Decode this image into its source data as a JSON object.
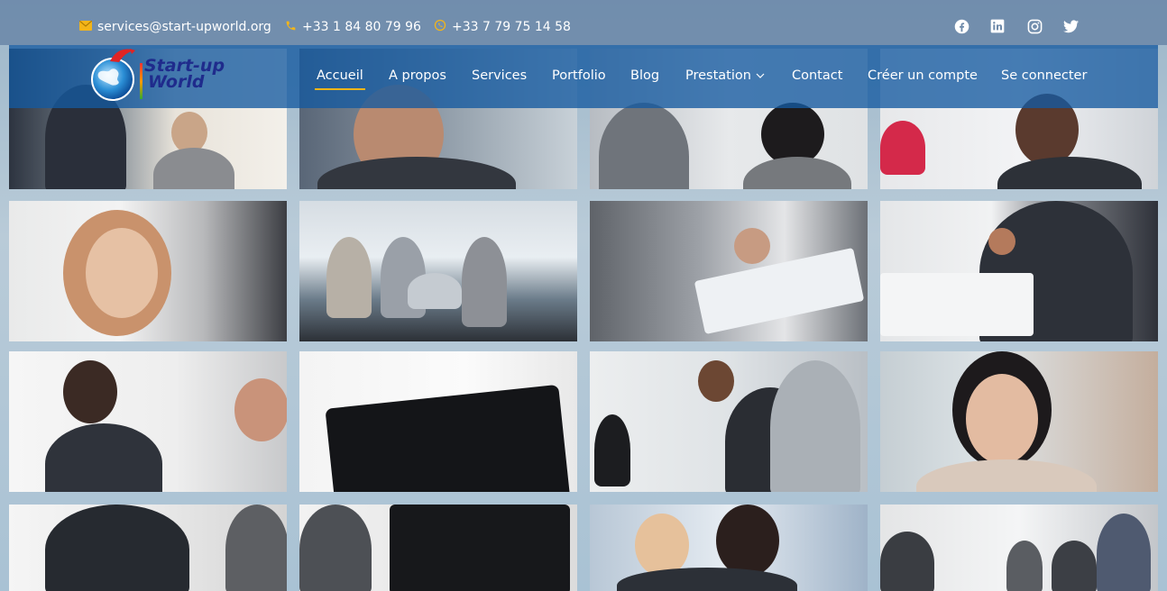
{
  "topbar": {
    "email": "services@start-upworld.org",
    "phone": "+33 1 84 80 79 96",
    "whatsapp": "+33 7 79 75 14 58",
    "social": [
      "facebook-icon",
      "linkedin-icon",
      "instagram-icon",
      "twitter-icon"
    ]
  },
  "logo": {
    "line1": "Start-up",
    "line2": "World"
  },
  "nav": [
    {
      "label": "Accueil",
      "active": true
    },
    {
      "label": "A propos"
    },
    {
      "label": "Services"
    },
    {
      "label": "Portfolio"
    },
    {
      "label": "Blog"
    },
    {
      "label": "Prestation",
      "dropdown": true
    },
    {
      "label": "Contact"
    },
    {
      "label": "Créer un compte"
    },
    {
      "label": "Se connecter"
    }
  ],
  "colors": {
    "accent": "#f3b519",
    "navbar": "#145aa0",
    "topbar": "#6e8aaa",
    "logo_text": "#1f2b8c"
  }
}
